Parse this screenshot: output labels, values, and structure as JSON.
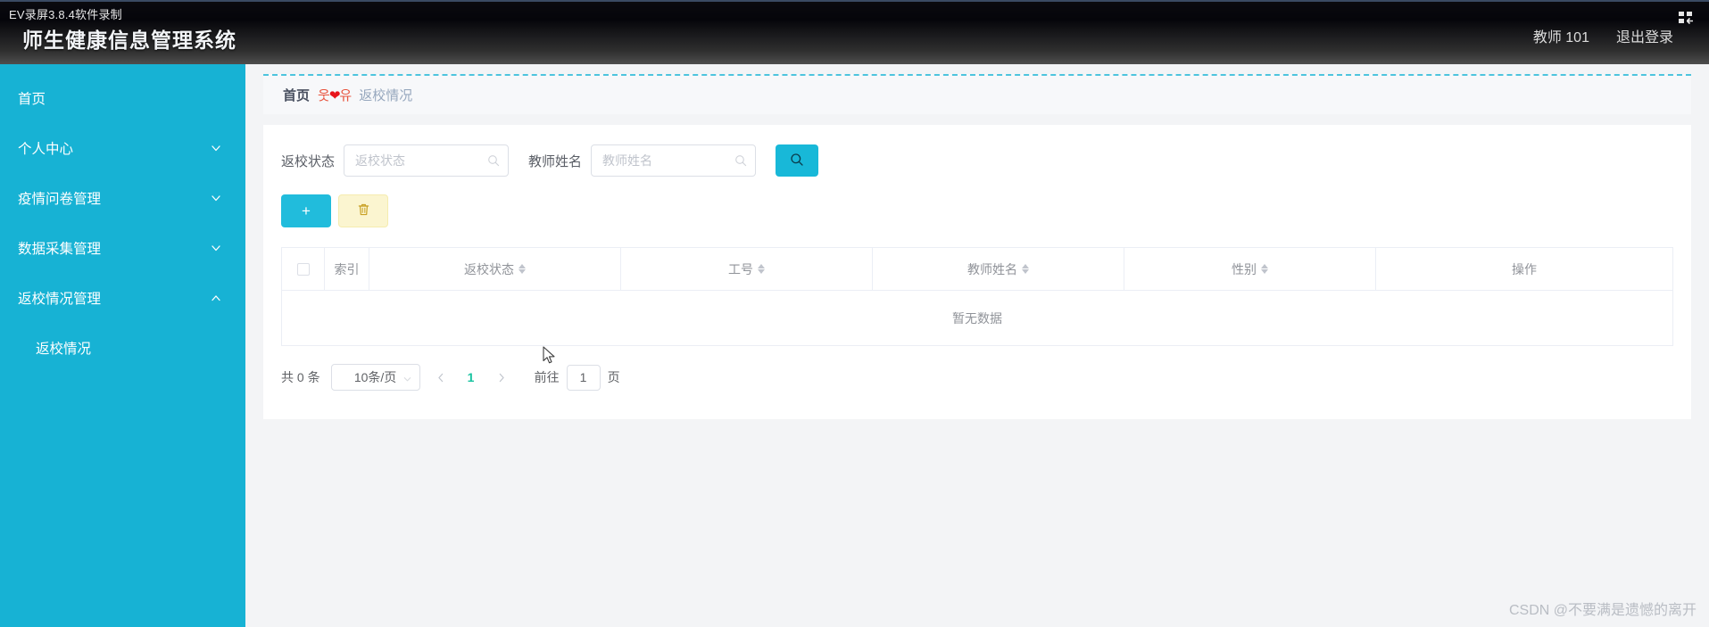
{
  "recorder": {
    "label": "EV录屏3.8.4软件录制",
    "icon": "window-restore-icon"
  },
  "header": {
    "title": "师生健康信息管理系统",
    "user": "教师 101",
    "logout": "退出登录"
  },
  "sidebar": {
    "bg_color": "#17b2d4",
    "items": [
      {
        "label": "首页",
        "icon": "none",
        "expandable": false,
        "sub": false
      },
      {
        "label": "个人中心",
        "icon": "chevron-down-icon",
        "expandable": true,
        "sub": false
      },
      {
        "label": "疫情问卷管理",
        "icon": "chevron-down-icon",
        "expandable": true,
        "sub": false
      },
      {
        "label": "数据采集管理",
        "icon": "chevron-down-icon",
        "expandable": true,
        "sub": false
      },
      {
        "label": "返校情况管理",
        "icon": "chevron-up-icon",
        "expandable": true,
        "sub": false
      },
      {
        "label": "返校情况",
        "icon": "none",
        "expandable": false,
        "sub": true
      }
    ]
  },
  "breadcrumb": {
    "home": "首页",
    "separator": "웃❤유",
    "current": "返校情况"
  },
  "search": {
    "status_label": "返校状态",
    "status_placeholder": "返校状态",
    "status_value": "",
    "name_label": "教师姓名",
    "name_placeholder": "教师姓名",
    "name_value": "",
    "button_icon": "search-icon",
    "button_color": "#18b8d8"
  },
  "toolbar": {
    "add_label": "+",
    "add_icon": "plus-icon",
    "delete_icon": "trash-icon"
  },
  "table": {
    "columns": [
      {
        "key": "check",
        "label": "",
        "sortable": false
      },
      {
        "key": "index",
        "label": "索引",
        "sortable": false
      },
      {
        "key": "status",
        "label": "返校状态",
        "sortable": true
      },
      {
        "key": "jobno",
        "label": "工号",
        "sortable": true
      },
      {
        "key": "name",
        "label": "教师姓名",
        "sortable": true
      },
      {
        "key": "gender",
        "label": "性别",
        "sortable": true
      },
      {
        "key": "action",
        "label": "操作",
        "sortable": false
      }
    ],
    "rows": [],
    "empty_text": "暂无数据"
  },
  "pagination": {
    "total_text": "共 0 条",
    "page_size": "10条/页",
    "prev_icon": "chevron-left-icon",
    "next_icon": "chevron-right-icon",
    "current_page": "1",
    "jump_prefix": "前往",
    "jump_value": "1",
    "jump_suffix": "页",
    "active_color": "#18c3a0"
  },
  "watermark": "CSDN @不要满是遗憾的离开"
}
